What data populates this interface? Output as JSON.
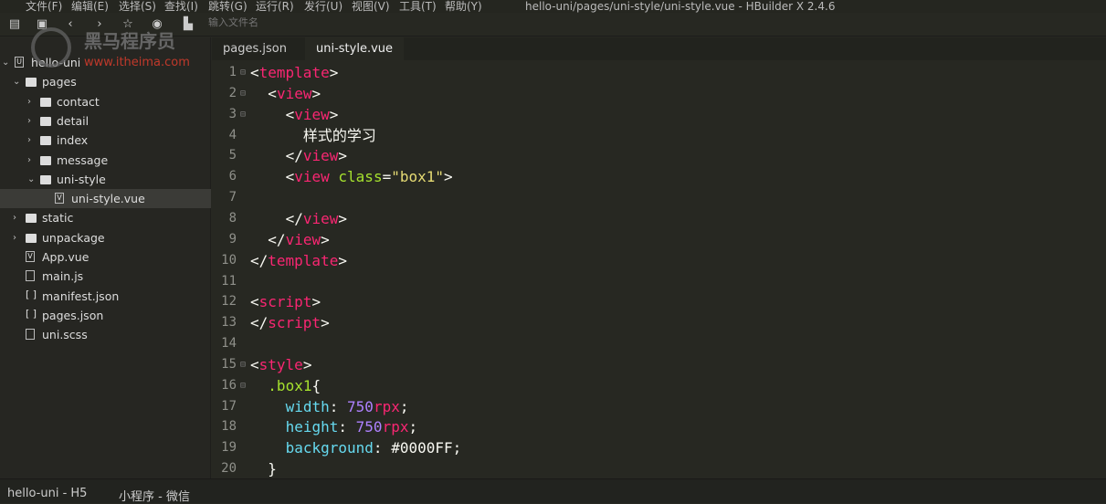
{
  "menubar": {
    "items": [
      "文件(F)",
      "编辑(E)",
      "选择(S)",
      "查找(I)",
      "跳转(G)",
      "运行(R)",
      "发行(U)",
      "视图(V)",
      "工具(T)",
      "帮助(Y)"
    ]
  },
  "window_title": "hello-uni/pages/uni-style/uni-style.vue - HBuilder X 2.4.6",
  "toolbar": {
    "file_search_placeholder": "输入文件名",
    "icons": [
      "new-file-icon",
      "save-icon",
      "back-icon",
      "forward-icon",
      "star-icon",
      "run-icon",
      "open-file-icon"
    ]
  },
  "watermark": {
    "name": "黑马程序员",
    "url": "www.itheima.com"
  },
  "sidebar": {
    "items": [
      {
        "label": "hello-uni",
        "type": "project",
        "depth": 0,
        "expanded": true
      },
      {
        "label": "pages",
        "type": "folder",
        "depth": 1,
        "expanded": true
      },
      {
        "label": "contact",
        "type": "folder",
        "depth": 2,
        "expanded": false
      },
      {
        "label": "detail",
        "type": "folder",
        "depth": 2,
        "expanded": false
      },
      {
        "label": "index",
        "type": "folder",
        "depth": 2,
        "expanded": false
      },
      {
        "label": "message",
        "type": "folder",
        "depth": 2,
        "expanded": false
      },
      {
        "label": "uni-style",
        "type": "folder",
        "depth": 2,
        "expanded": true
      },
      {
        "label": "uni-style.vue",
        "type": "vue",
        "depth": 3,
        "selected": true
      },
      {
        "label": "static",
        "type": "folder",
        "depth": 1,
        "expanded": false
      },
      {
        "label": "unpackage",
        "type": "folder",
        "depth": 1,
        "expanded": false
      },
      {
        "label": "App.vue",
        "type": "vue",
        "depth": 1
      },
      {
        "label": "main.js",
        "type": "js",
        "depth": 1
      },
      {
        "label": "manifest.json",
        "type": "json",
        "depth": 1
      },
      {
        "label": "pages.json",
        "type": "json",
        "depth": 1
      },
      {
        "label": "uni.scss",
        "type": "scss",
        "depth": 1
      }
    ]
  },
  "tabs": [
    {
      "label": "pages.json",
      "active": false
    },
    {
      "label": "uni-style.vue",
      "active": true
    }
  ],
  "editor": {
    "lines": [
      {
        "n": "1",
        "fold": true,
        "indent": 0,
        "tokens": [
          [
            "<",
            "p"
          ],
          [
            "template",
            "tag"
          ],
          [
            ">",
            "p"
          ]
        ]
      },
      {
        "n": "2",
        "fold": true,
        "indent": 1,
        "tokens": [
          [
            "<",
            "p"
          ],
          [
            "view",
            "tag"
          ],
          [
            ">",
            "p"
          ]
        ]
      },
      {
        "n": "3",
        "fold": true,
        "indent": 2,
        "tokens": [
          [
            "<",
            "p"
          ],
          [
            "view",
            "tag"
          ],
          [
            ">",
            "p"
          ]
        ]
      },
      {
        "n": "4",
        "indent": 3,
        "tokens": [
          [
            "样式的学习",
            "txt"
          ]
        ]
      },
      {
        "n": "5",
        "indent": 2,
        "tokens": [
          [
            "</",
            "p"
          ],
          [
            "view",
            "tag"
          ],
          [
            ">",
            "p"
          ]
        ]
      },
      {
        "n": "6",
        "indent": 2,
        "tokens": [
          [
            "<",
            "p"
          ],
          [
            "view",
            "tag"
          ],
          [
            " ",
            "p"
          ],
          [
            "class",
            "attr"
          ],
          [
            "=",
            "p"
          ],
          [
            "\"box1\"",
            "str"
          ],
          [
            ">",
            "p"
          ]
        ]
      },
      {
        "n": "7",
        "indent": 0,
        "tokens": []
      },
      {
        "n": "8",
        "indent": 2,
        "tokens": [
          [
            "</",
            "p"
          ],
          [
            "view",
            "tag"
          ],
          [
            ">",
            "p"
          ]
        ]
      },
      {
        "n": "9",
        "indent": 1,
        "tokens": [
          [
            "</",
            "p"
          ],
          [
            "view",
            "tag"
          ],
          [
            ">",
            "p"
          ]
        ]
      },
      {
        "n": "10",
        "indent": 0,
        "tokens": [
          [
            "</",
            "p"
          ],
          [
            "template",
            "tag"
          ],
          [
            ">",
            "p"
          ]
        ]
      },
      {
        "n": "11",
        "indent": 0,
        "tokens": []
      },
      {
        "n": "12",
        "indent": 0,
        "tokens": [
          [
            "<",
            "p"
          ],
          [
            "script",
            "tag"
          ],
          [
            ">",
            "p"
          ]
        ]
      },
      {
        "n": "13",
        "indent": 0,
        "tokens": [
          [
            "</",
            "p"
          ],
          [
            "script",
            "tag"
          ],
          [
            ">",
            "p"
          ]
        ]
      },
      {
        "n": "14",
        "indent": 0,
        "tokens": []
      },
      {
        "n": "15",
        "fold": true,
        "indent": 0,
        "tokens": [
          [
            "<",
            "p"
          ],
          [
            "style",
            "tag"
          ],
          [
            ">",
            "p"
          ]
        ]
      },
      {
        "n": "16",
        "fold": true,
        "indent": 1,
        "tokens": [
          [
            ".box1",
            "attr"
          ],
          [
            "{",
            "p"
          ]
        ]
      },
      {
        "n": "17",
        "indent": 2,
        "tokens": [
          [
            "width",
            "prop"
          ],
          [
            ": ",
            "p"
          ],
          [
            "750",
            "num"
          ],
          [
            "rpx",
            "unit"
          ],
          [
            ";",
            "p"
          ]
        ]
      },
      {
        "n": "18",
        "indent": 2,
        "tokens": [
          [
            "height",
            "prop"
          ],
          [
            ": ",
            "p"
          ],
          [
            "750",
            "num"
          ],
          [
            "rpx",
            "unit"
          ],
          [
            ";",
            "p"
          ]
        ]
      },
      {
        "n": "19",
        "indent": 2,
        "tokens": [
          [
            "background",
            "prop"
          ],
          [
            ": ",
            "p"
          ],
          [
            "#0000FF",
            "p"
          ],
          [
            ";",
            "p"
          ]
        ]
      },
      {
        "n": "20",
        "indent": 1,
        "tokens": [
          [
            "}",
            "p"
          ]
        ]
      }
    ]
  },
  "statusbar": {
    "items": [
      "hello-uni - H5",
      "小程序 - 微信"
    ]
  }
}
